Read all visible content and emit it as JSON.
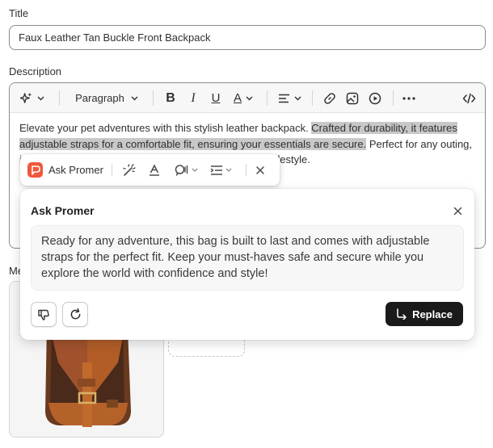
{
  "title_field": {
    "label": "Title",
    "value": "Faux Leather Tan Buckle Front Backpack"
  },
  "description": {
    "label": "Description",
    "toolbar": {
      "magic_icon": "sparkle-icon",
      "block_format": "Paragraph",
      "bold": "B",
      "italic": "I",
      "underline": "U",
      "text_color": "A"
    },
    "text_before": "Elevate your pet adventures with this stylish leather backpack. ",
    "text_selected": "Crafted for durability, it features adjustable straps for a comfortable fit, ensuring your essentials are secure.",
    "text_after": " Perfect for any outing, it combines elegance with functionality for a seamless lifestyle.",
    "selection_color": "#c8c8c8"
  },
  "ask_toolbar": {
    "name": "Ask Promer",
    "brand_color": "#f0573b"
  },
  "media": {
    "label": "Media",
    "image_alt": "Tan leather backpack with buckle front"
  },
  "ask_panel": {
    "title": "Ask Promer",
    "response": "Ready for any adventure, this bag is built to last and comes with adjustable straps for the perfect fit. Keep your must-haves safe and secure while you explore the world with confidence and style!",
    "replace_label": "Replace"
  }
}
